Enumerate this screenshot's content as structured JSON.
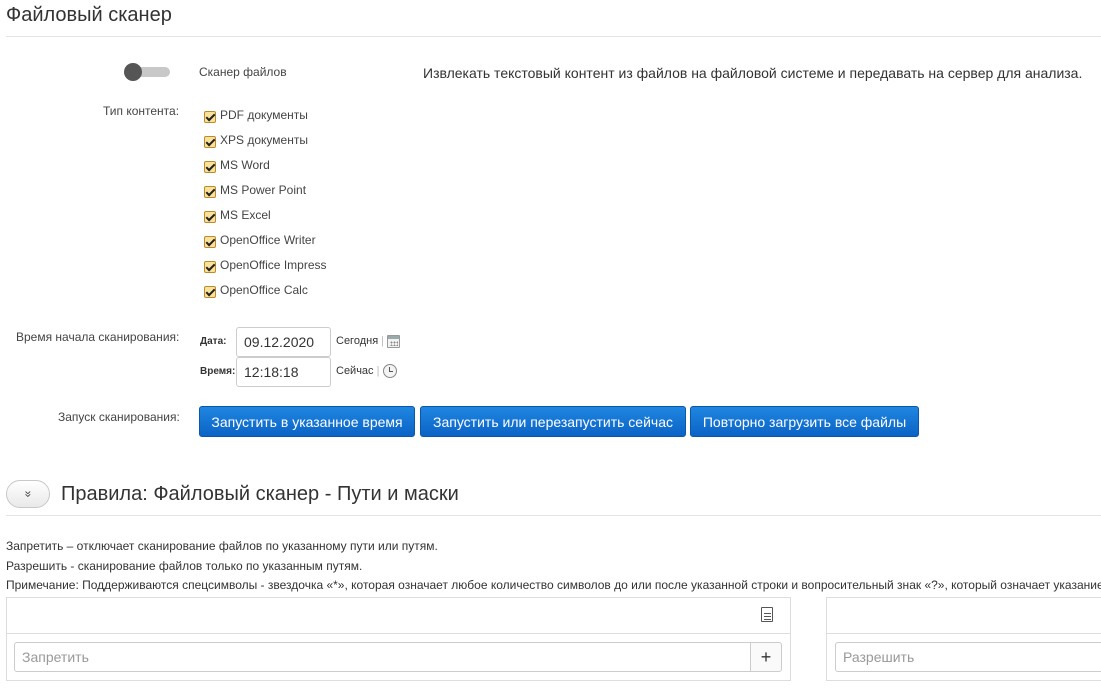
{
  "page": {
    "title": "Файловый сканер"
  },
  "scanner": {
    "toggle_label": "Сканер файлов",
    "toggle_on": false,
    "description": "Извлекать текстовый контент из файлов на файловой системе и передавать на сервер для анализа."
  },
  "content_type": {
    "label": "Тип контента:",
    "items": [
      {
        "label": "PDF документы",
        "checked": true
      },
      {
        "label": "XPS документы",
        "checked": true
      },
      {
        "label": "MS Word",
        "checked": true
      },
      {
        "label": "MS Power Point",
        "checked": true
      },
      {
        "label": "MS Excel",
        "checked": true
      },
      {
        "label": "OpenOffice Writer",
        "checked": true
      },
      {
        "label": "OpenOffice Impress",
        "checked": true
      },
      {
        "label": "OpenOffice Calc",
        "checked": true
      }
    ]
  },
  "schedule": {
    "label": "Время начала сканирования:",
    "date_label": "Дата:",
    "date_value": "09.12.2020",
    "today_link": "Сегодня",
    "time_label": "Время:",
    "time_value": "12:18:18",
    "now_link": "Сейчас",
    "separator": "|"
  },
  "launch": {
    "label": "Запуск сканирования:",
    "buttons": {
      "scheduled": "Запустить в указанное время",
      "restart": "Запустить или перезапустить сейчас",
      "reload": "Повторно загрузить все файлы"
    }
  },
  "rules": {
    "collapse_icon": "chevrons-down-icon",
    "collapse_glyph": "»",
    "title": "Правила: Файловый сканер - Пути и маски",
    "notes": [
      "Запретить – отключает сканирование файлов по указанному пути или путям.",
      "Разрешить - сканирование файлов только по указанным путям.",
      "Примечание: Поддерживаются спецсимволы - звездочка «*», которая означает любое количество символов до или после указанной строки и вопросительный знак «?», который означает указание"
    ],
    "deny_placeholder": "Запретить",
    "allow_placeholder": "Разрешить",
    "add_label": "+"
  },
  "colors": {
    "button_blue": "#0b63c6",
    "checkbox_fill": "#fbe29a"
  }
}
